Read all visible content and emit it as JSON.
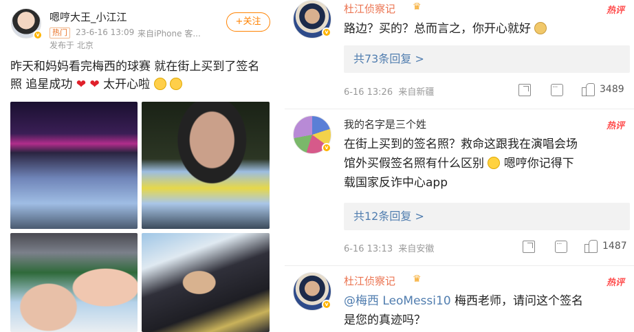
{
  "post": {
    "author": "嗯哼大王_小江江",
    "tag": "热门",
    "time": "23-6-16 13:09",
    "source": "来自iPhone 客...",
    "location": "发布于 北京",
    "follow_label": "+关注",
    "text_line1": "昨天和妈妈看完梅西的球赛 就在街上买到了签名",
    "text_line2_a": "照 追星成功",
    "text_line2_b": "太开心啦",
    "heart_glyph": "❤"
  },
  "comments": [
    {
      "name": "杜江侦察记",
      "hot_label": "热评",
      "text": "路边？买的？总而言之，你开心就好",
      "replies": "共73条回复 >",
      "date": "6-16 13:26",
      "source": "来自新疆",
      "likes": "3489"
    },
    {
      "name": "我的名字是三个姓",
      "hot_label": "热评",
      "text_line1": "在街上买到的签名照？救命这跟我在演唱会场",
      "text_line2_a": "馆外买假签名照有什么区别",
      "text_line2_b": "嗯哼你记得下",
      "text_line3": "载国家反诈中心app",
      "replies": "共12条回复 >",
      "date": "6-16 13:13",
      "source": "来自安徽",
      "likes": "1487"
    },
    {
      "name": "杜江侦察记",
      "hot_label": "热评",
      "mention": "@梅西 LeoMessi10",
      "text_line1_rest": " 梅西老师，请问这个签名",
      "text_line2": "是您的真迹吗？"
    }
  ],
  "icons": {
    "share": "share-icon",
    "comment": "comment-icon",
    "like": "like-icon",
    "crown": "crown-icon",
    "verified": "verified-badge-icon"
  },
  "colors": {
    "orange_name": "#eb7350",
    "hot_red": "#ff4d4d",
    "link_blue": "#507daf",
    "follow_orange": "#ff8200"
  }
}
